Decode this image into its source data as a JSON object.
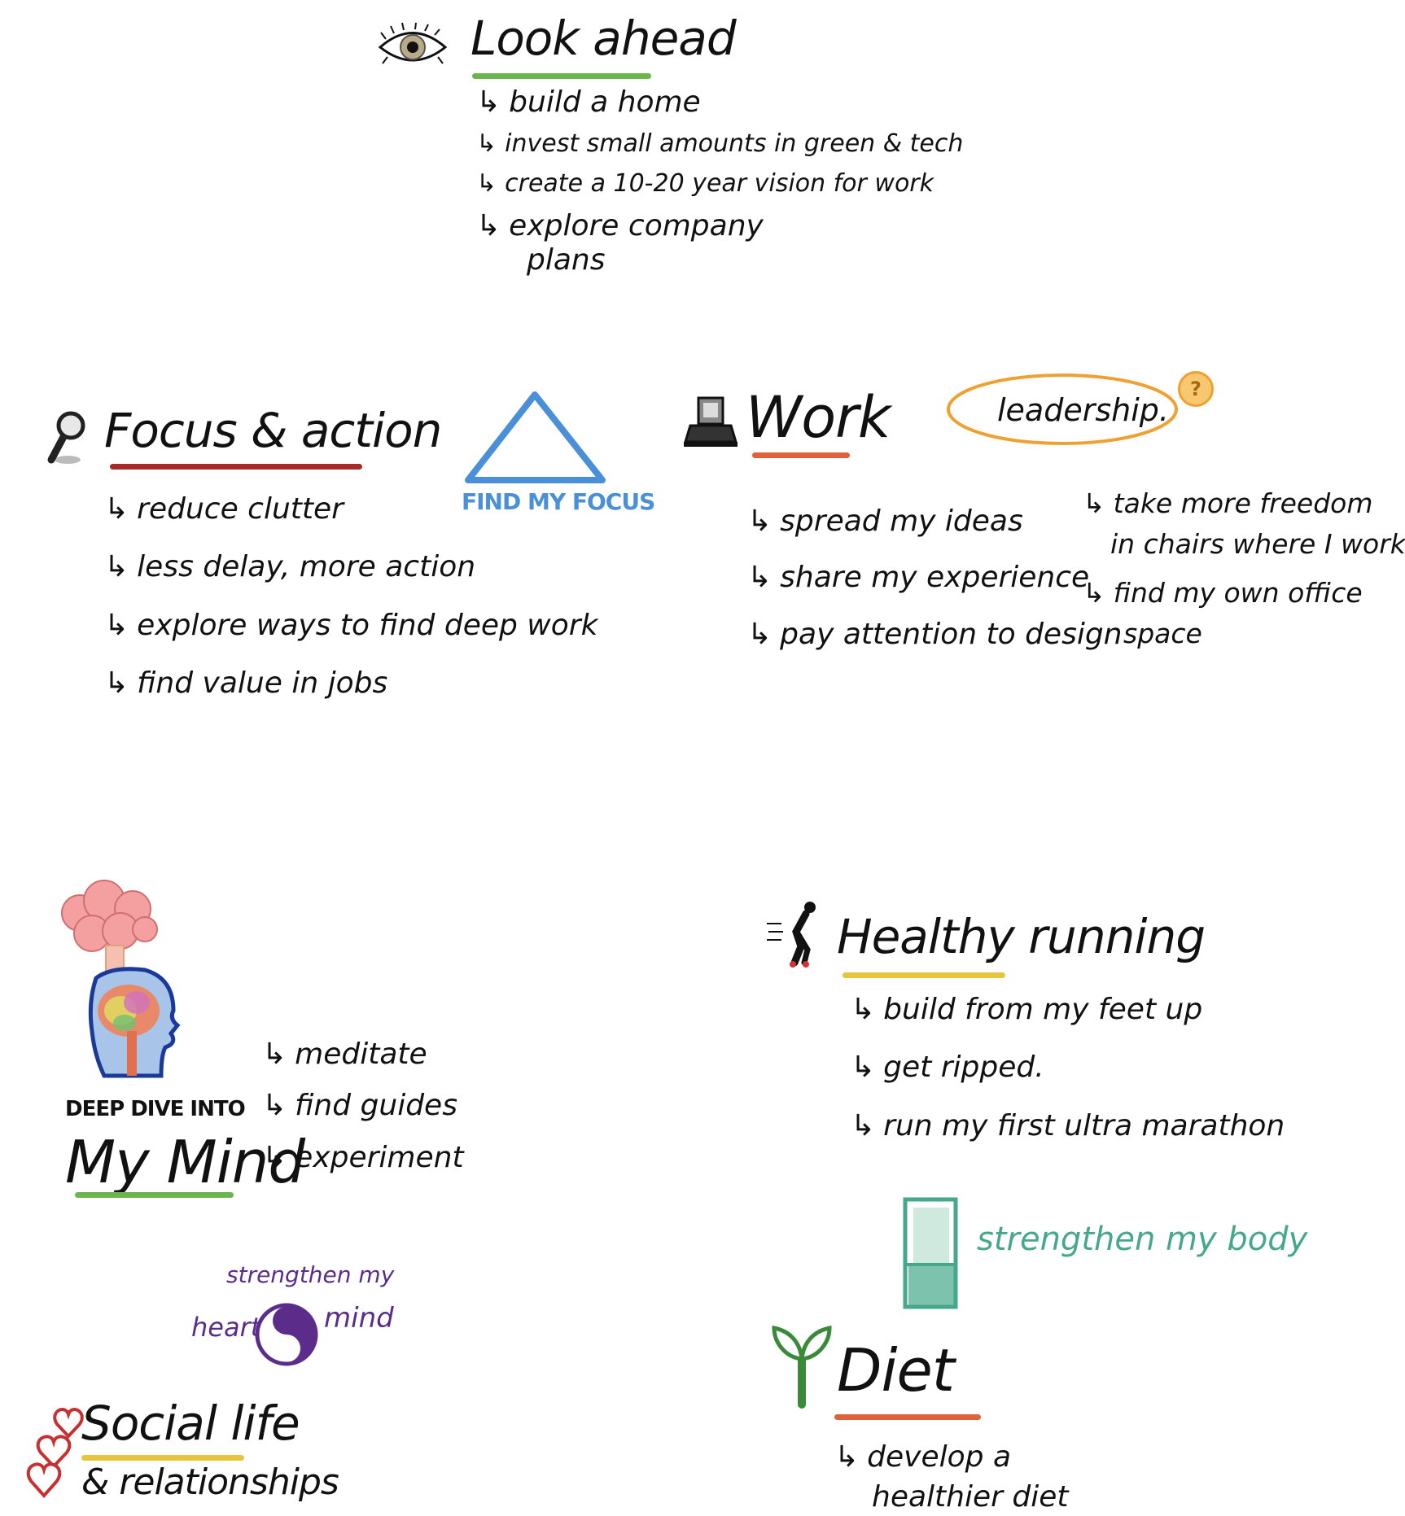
{
  "colors": {
    "ink": "#111111",
    "green": "#6cb44c",
    "red": "#a82a24",
    "orange": "#e0623a",
    "yellow": "#e8c33c",
    "blue": "#4a90d9",
    "purple": "#5b2c8a",
    "teal": "#46a88a",
    "leader_orange": "#f0a030"
  },
  "look_ahead": {
    "icon": "eye-icon",
    "title": "Look ahead",
    "items": [
      "build a home",
      "invest small amounts in green & tech",
      "create a 10-20 year vision for work",
      "explore company",
      "plans"
    ]
  },
  "focus": {
    "icon": "magnifier-icon",
    "title": "Focus & action",
    "triangle_caption": "FIND MY FOCUS",
    "items": [
      "reduce clutter",
      "less delay, more action",
      "explore ways to find deep work",
      "find value in jobs"
    ]
  },
  "work": {
    "icon": "laptop-icon",
    "title": "Work",
    "leadership_label": "leadership.",
    "question_badge": "?",
    "items": [
      "spread my ideas",
      "share my experience",
      "pay attention to design"
    ],
    "leadership_items": [
      "take more freedom",
      "in chairs where I work",
      "find my own office",
      "space"
    ]
  },
  "mind": {
    "icon": "brain-head-icon",
    "caption_small": "DEEP DIVE INTO",
    "caption_big": "My Mind",
    "items": [
      "meditate",
      "find guides",
      "experiment"
    ],
    "heart_mind": {
      "top": "strengthen my",
      "left": "heart",
      "right": "mind"
    }
  },
  "running": {
    "icon": "runner-icon",
    "title": "Healthy running",
    "items": [
      "build from my feet up",
      "get ripped.",
      "run my first ultra marathon"
    ],
    "body_label": "strengthen my body"
  },
  "social": {
    "icon": "hearts-icon",
    "title_line1": "Social life",
    "title_line2": "& relationships"
  },
  "diet": {
    "icon": "sprout-icon",
    "title": "Diet",
    "items": [
      "develop a",
      "healthier diet"
    ]
  }
}
